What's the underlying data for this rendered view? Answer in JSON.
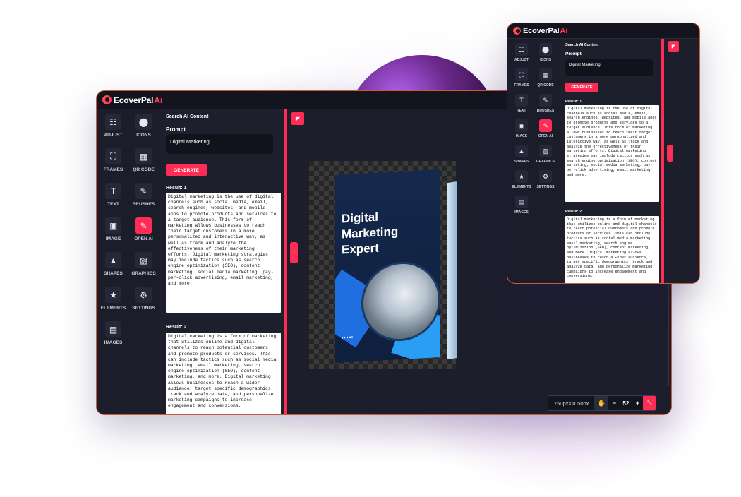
{
  "app": {
    "logo_main": "EcoverPal",
    "logo_ai": "Ai"
  },
  "tools": [
    {
      "label": "ADJUST",
      "icon": "sliders-icon",
      "glyph": "☷"
    },
    {
      "label": "ICONS",
      "icon": "map-pin-icon",
      "glyph": "⬤"
    },
    {
      "label": "FRAMES",
      "icon": "frame-icon",
      "glyph": "⛶"
    },
    {
      "label": "QR CODE",
      "icon": "qr-code-icon",
      "glyph": "▦"
    },
    {
      "label": "TEXT",
      "icon": "text-icon",
      "glyph": "T"
    },
    {
      "label": "BRUSHES",
      "icon": "brush-icon",
      "glyph": "✎"
    },
    {
      "label": "IMAGE",
      "icon": "image-add-icon",
      "glyph": "▣"
    },
    {
      "label": "OPEN AI",
      "icon": "pencil-icon",
      "glyph": "✎"
    },
    {
      "label": "SHAPES",
      "icon": "shapes-icon",
      "glyph": "▲"
    },
    {
      "label": "GRAPHICS",
      "icon": "graphics-icon",
      "glyph": "▨"
    },
    {
      "label": "ELEMENTS",
      "icon": "star-icon",
      "glyph": "★"
    },
    {
      "label": "SETTINGS",
      "icon": "gear-icon",
      "glyph": "⚙"
    },
    {
      "label": "IMAGES",
      "icon": "images-icon",
      "glyph": "▤"
    }
  ],
  "active_tool": "OPEN AI",
  "panel": {
    "title": "Search AI Content",
    "prompt_label": "Prompt",
    "prompt_value": "Digital Marketing",
    "generate_label": "GENERATE",
    "results": [
      {
        "label": "Result: 1",
        "text": "Digital marketing is the use of digital channels such as social media, email, search engines, websites, and mobile apps to promote products and services to a target audience. This form of marketing allows businesses to reach their target customers in a more personalized and interactive way, as well as track and analyze the effectiveness of their marketing efforts. Digital marketing strategies may include tactics such as search engine optimization (SEO), content marketing, social media marketing, pay-per-click advertising, email marketing, and more."
      },
      {
        "label": "Result: 2",
        "text": "Digital marketing is a form of marketing that utilizes online and digital channels to reach potential customers and promote products or services. This can include tactics such as social media marketing, email marketing, search engine optimization (SEO), content marketing, and more. Digital marketing allows businesses to reach a wider audience, target specific demographics, track and analyze data, and personalize marketing campaigns to increase engagement and conversions."
      }
    ]
  },
  "book": {
    "title": "Digital Marketing Expert"
  },
  "statusbar": {
    "dimensions": "750px×1050px",
    "zoom": "52",
    "minus": "−",
    "plus": "+"
  }
}
